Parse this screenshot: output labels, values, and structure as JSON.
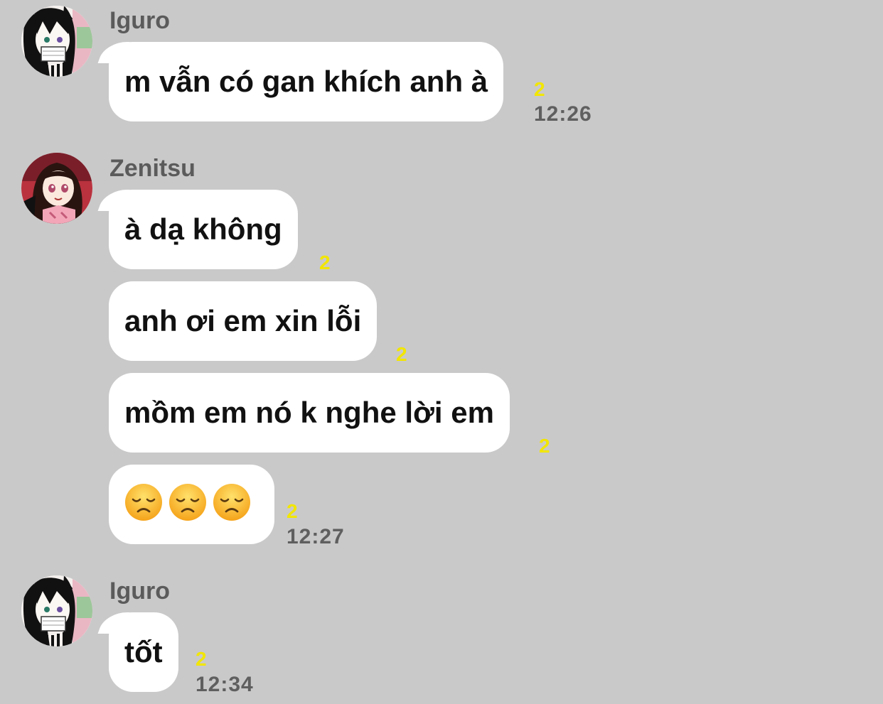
{
  "chat": {
    "groups": [
      {
        "sender": "Iguro",
        "messages": [
          {
            "text": "m vẫn có gan khích anh à",
            "read_count": "2",
            "time": "12:26"
          }
        ]
      },
      {
        "sender": "Zenitsu",
        "messages": [
          {
            "text": "à dạ không",
            "read_count": "2"
          },
          {
            "text": "anh ơi em xin lỗi",
            "read_count": "2"
          },
          {
            "text": "mồm em nó k nghe lời em",
            "read_count": "2"
          },
          {
            "emoji": [
              "disappointed-face",
              "disappointed-face",
              "disappointed-face"
            ],
            "read_count": "2",
            "time": "12:27"
          }
        ]
      },
      {
        "sender": "Iguro",
        "messages": [
          {
            "text": "tốt",
            "read_count": "2",
            "time": "12:34"
          }
        ]
      }
    ]
  },
  "colors": {
    "background": "#c9c9c9",
    "bubble": "#ffffff",
    "read_count": "#f2e600",
    "sender_name": "#5b5b5b",
    "timestamp": "#5f5f5f"
  }
}
